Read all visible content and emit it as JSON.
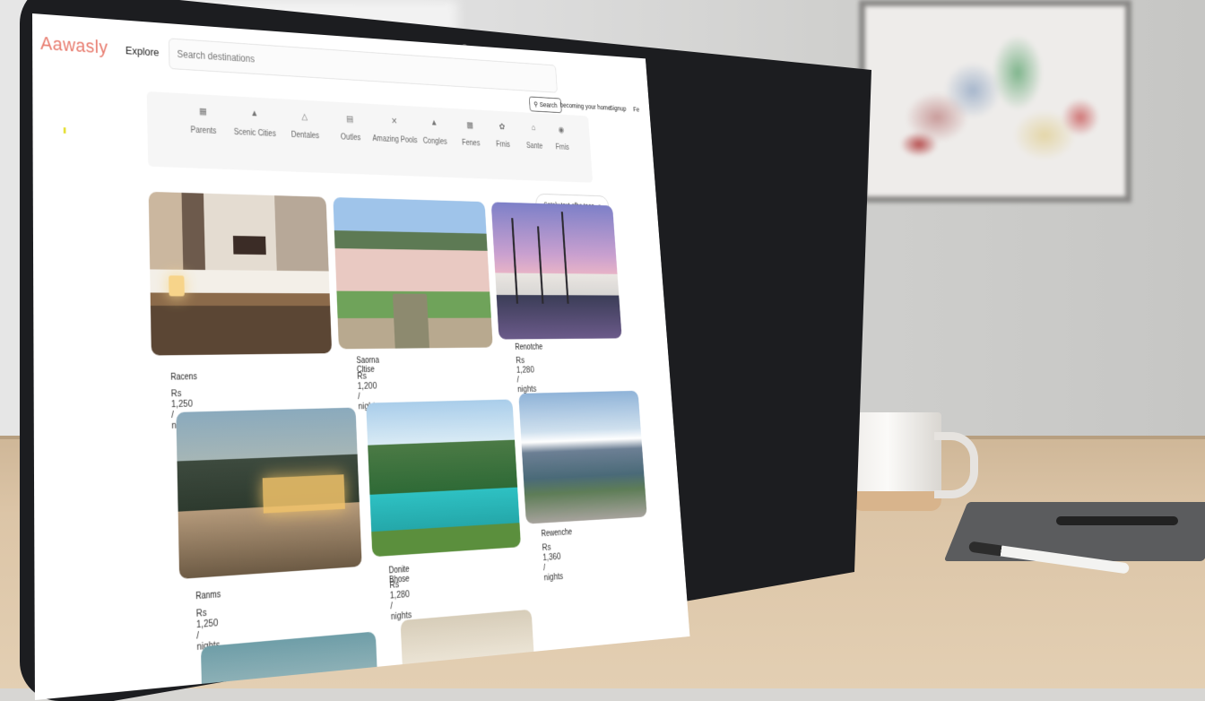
{
  "brand": {
    "logo": "Aawasly"
  },
  "nav": {
    "explore": "Explore"
  },
  "search": {
    "placeholder": "Search destinations",
    "button": "Search"
  },
  "header_links": {
    "link1": "becoming your home",
    "link2": "Signup",
    "link3": "Fe"
  },
  "categories": [
    {
      "icon": "grid-icon",
      "label": "Parents"
    },
    {
      "icon": "mountain-icon",
      "label": "Scenic Cities"
    },
    {
      "icon": "tent-icon",
      "label": "Dentales"
    },
    {
      "icon": "bed-icon",
      "label": "Outles"
    },
    {
      "icon": "close-icon",
      "label": "Amazing Pools"
    },
    {
      "icon": "tent-icon",
      "label": "Congles"
    },
    {
      "icon": "car-icon",
      "label": "Fenes"
    },
    {
      "icon": "flower-icon",
      "label": "Frnis"
    },
    {
      "icon": "hut-icon",
      "label": "Sante"
    },
    {
      "icon": "lock-icon",
      "label": "Frnis"
    }
  ],
  "filter": {
    "label": "Sately text ofhe taes"
  },
  "listings": [
    {
      "name": "Racens",
      "price": "Rs 1,250 / nights"
    },
    {
      "name": "Saorna Cltise",
      "price": "Rs 1,200 / nights"
    },
    {
      "name": "Renotche",
      "price": "Rs 1,280 / nights"
    },
    {
      "name": "Ranms",
      "price": "Rs 1,250 / nights"
    },
    {
      "name": "Donite Bhose",
      "price": "Rs 1,280 / nights"
    },
    {
      "name": "Rewenche",
      "price": "Rs 1,360 / nights"
    }
  ],
  "colors": {
    "brand": "#e87c6f",
    "bezel": "#1c1d20",
    "desk": "#dcc5a7"
  }
}
